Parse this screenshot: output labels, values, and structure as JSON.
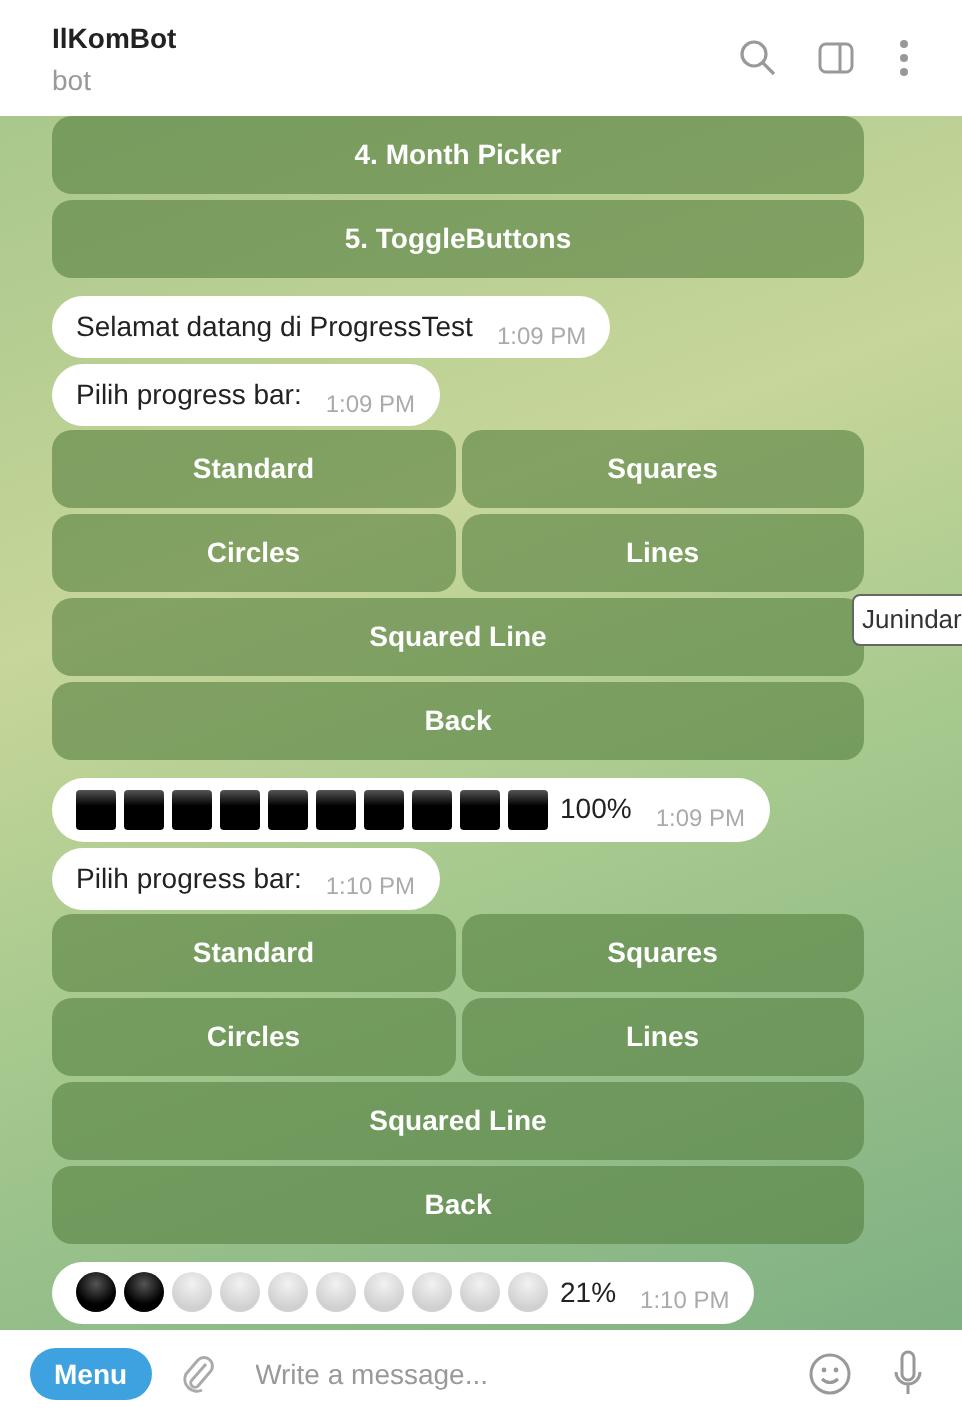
{
  "header": {
    "title": "IlKomBot",
    "subtitle": "bot"
  },
  "messages": [
    {
      "kind": "keyboard",
      "rows": [
        [
          {
            "label": "4. Month Picker"
          }
        ],
        [
          {
            "label": "5. ToggleButtons"
          }
        ]
      ]
    },
    {
      "kind": "text",
      "text": "Selamat datang di ProgressTest",
      "time": "1:09 PM"
    },
    {
      "kind": "text",
      "text": "Pilih progress bar:",
      "time": "1:09 PM"
    },
    {
      "kind": "keyboard",
      "rows": [
        [
          {
            "label": "Standard"
          },
          {
            "label": "Squares"
          }
        ],
        [
          {
            "label": "Circles"
          },
          {
            "label": "Lines"
          }
        ],
        [
          {
            "label": "Squared Line"
          }
        ],
        [
          {
            "label": "Back"
          }
        ]
      ]
    },
    {
      "kind": "square-progress",
      "cells": [
        {
          "filled": true
        },
        {
          "filled": true
        },
        {
          "filled": true
        },
        {
          "filled": true
        },
        {
          "filled": true
        },
        {
          "filled": true
        },
        {
          "filled": true
        },
        {
          "filled": true
        },
        {
          "filled": true
        },
        {
          "filled": true
        }
      ],
      "reading": "100%",
      "time": "1:09 PM"
    },
    {
      "kind": "text",
      "text": "Pilih progress bar:",
      "time": "1:10 PM"
    },
    {
      "kind": "keyboard",
      "rows": [
        [
          {
            "label": "Standard"
          },
          {
            "label": "Squares"
          }
        ],
        [
          {
            "label": "Circles"
          },
          {
            "label": "Lines"
          }
        ],
        [
          {
            "label": "Squared Line"
          }
        ],
        [
          {
            "label": "Back"
          }
        ]
      ]
    },
    {
      "kind": "circle-progress",
      "cells": [
        {
          "filled": true
        },
        {
          "filled": true
        },
        {
          "filled": false
        },
        {
          "filled": false
        },
        {
          "filled": false
        },
        {
          "filled": false
        },
        {
          "filled": false
        },
        {
          "filled": false
        },
        {
          "filled": false
        },
        {
          "filled": false
        }
      ],
      "reading": "21%",
      "time": "1:10 PM"
    }
  ],
  "tooltip": {
    "text": "Junindar"
  },
  "composer": {
    "menu": "Menu",
    "placeholder": "Write a message..."
  }
}
